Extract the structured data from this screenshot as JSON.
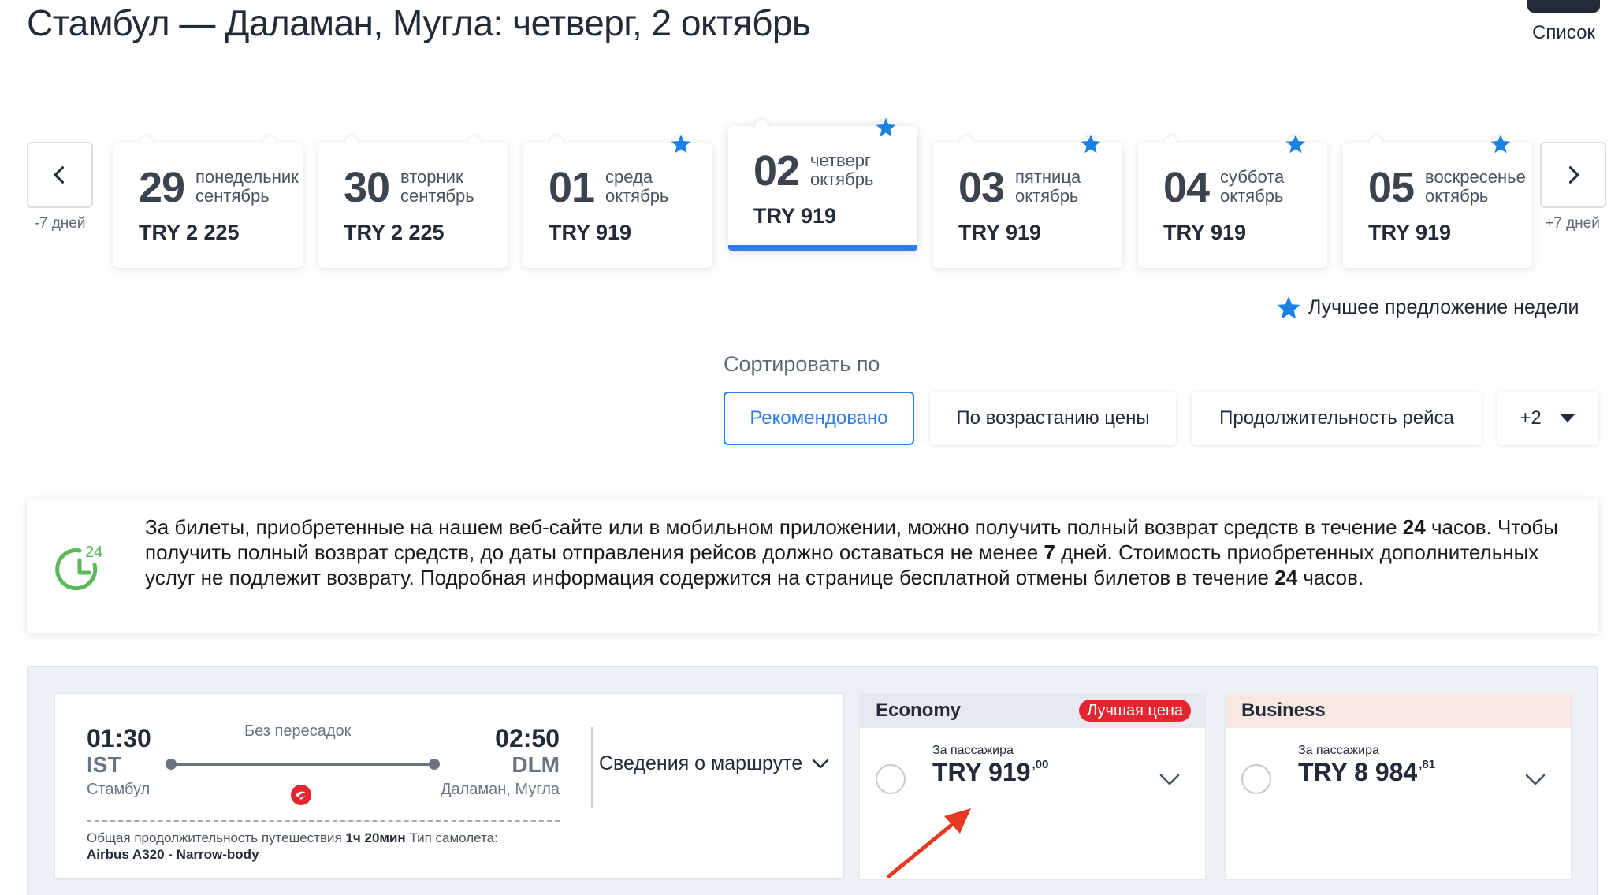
{
  "header": {
    "title": "Стамбул — Даламан, Мугла: четверг, 2 октябрь",
    "list_label": "Список"
  },
  "date_nav": {
    "prev_caption": "-7 дней",
    "next_caption": "+7 дней",
    "days": [
      {
        "num": "29",
        "weekday": "понедельник",
        "month": "сентябрь",
        "price": "TRY 2 225",
        "best": false,
        "active": false
      },
      {
        "num": "30",
        "weekday": "вторник",
        "month": "сентябрь",
        "price": "TRY 2 225",
        "best": false,
        "active": false
      },
      {
        "num": "01",
        "weekday": "среда",
        "month": "октябрь",
        "price": "TRY 919",
        "best": true,
        "active": false
      },
      {
        "num": "02",
        "weekday": "четверг",
        "month": "октябрь",
        "price": "TRY 919",
        "best": true,
        "active": true
      },
      {
        "num": "03",
        "weekday": "пятница",
        "month": "октябрь",
        "price": "TRY 919",
        "best": true,
        "active": false
      },
      {
        "num": "04",
        "weekday": "суббота",
        "month": "октябрь",
        "price": "TRY 919",
        "best": true,
        "active": false
      },
      {
        "num": "05",
        "weekday": "воскресенье",
        "month": "октябрь",
        "price": "TRY 919",
        "best": true,
        "active": false
      }
    ],
    "legend": "Лучшее предложение недели"
  },
  "sort": {
    "title": "Сортировать по",
    "options": [
      "Рекомендовано",
      "По возрастанию цены",
      "Продолжительность рейса",
      "+2"
    ],
    "selected": "Рекомендовано"
  },
  "info": {
    "icon_number": "24",
    "t1": "За билеты, приобретенные на нашем веб-сайте или в мобильном приложении, можно получить полный возврат средств в течение ",
    "b1": "24",
    "t2": " часов. Чтобы получить полный возврат средств, до даты отправления рейсов должно оставаться не менее ",
    "b2": "7",
    "t3": " дней. Стоимость приобретенных дополнительных услуг не подлежит возврату. Подробная информация содержится на странице бесплатной отмены билетов в течение ",
    "b3": "24",
    "t4": " часов."
  },
  "flight": {
    "dep_time": "01:30",
    "dep_code": "IST",
    "dep_city": "Стамбул",
    "arr_time": "02:50",
    "arr_code": "DLM",
    "arr_city": "Даламан, Мугла",
    "stops": "Без пересадок",
    "route_details": "Сведения о маршруте",
    "duration_label": "Общая продолжительность путешествия",
    "duration_value": "1ч 20мин",
    "aircraft_label": "Тип самолета:",
    "aircraft_value": "Airbus A320 - Narrow-body"
  },
  "fares": {
    "economy": {
      "name": "Economy",
      "badge": "Лучшая цена",
      "per_pax": "За пассажира",
      "price": "TRY 919",
      "cents": ",00"
    },
    "business": {
      "name": "Business",
      "per_pax": "За пассажира",
      "price": "TRY 8 984",
      "cents": ",81"
    }
  },
  "colors": {
    "accent": "#2e7ee8",
    "best_badge": "#e3262f",
    "star": "#1a82e2",
    "icon_green": "#5cb85c",
    "annotation_arrow": "#e53a22"
  }
}
